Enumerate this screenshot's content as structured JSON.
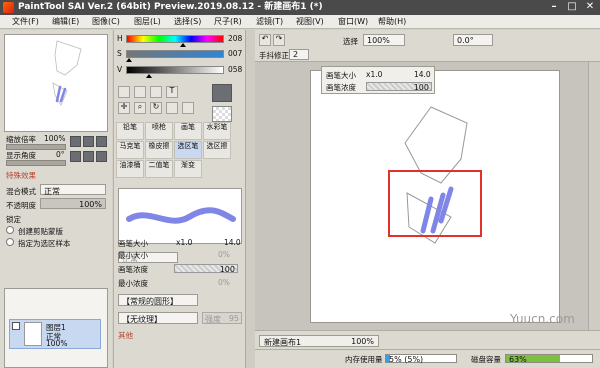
{
  "window": {
    "title": "PaintTool SAI Ver.2 (64bit) Preview.2019.08.12 - 新建画布1 (*)",
    "minimize": "–",
    "maximize": "□",
    "close": "✕"
  },
  "menu": [
    "文件(F)",
    "编辑(E)",
    "图像(C)",
    "图层(L)",
    "选择(S)",
    "尺子(R)",
    "滤镜(T)",
    "视图(V)",
    "窗口(W)",
    "帮助(H)"
  ],
  "navigator": {
    "zoom_label": "缩放倍率",
    "zoom_value": "100%",
    "angle_label": "显示角度",
    "angle_value": "0°"
  },
  "color": {
    "h_label": "H",
    "h_value": "208",
    "s_label": "S",
    "s_value": "007",
    "v_label": "V",
    "v_value": "058",
    "fg": "#6b6f74",
    "h_frac": 0.58,
    "s_frac": 0.03,
    "v_frac": 0.23
  },
  "layer_props": {
    "section": "特殊效果",
    "blend_label": "混合模式",
    "blend_value": "正常",
    "opacity_label": "不透明度",
    "opacity_value": "100%",
    "lock_label": "锁定",
    "clip_label": "创建剪贴蒙版",
    "ref_label": "指定为选区样本"
  },
  "brush_tabs": [
    [
      "铅笔",
      "喷枪",
      "画笔",
      "水彩笔"
    ],
    [
      "马克笔",
      "橡皮擦",
      "选区笔",
      "选区擦"
    ],
    [
      "油漆桶",
      "二值笔",
      "渐变",
      ""
    ]
  ],
  "brush_mode": "正常",
  "brush_params": {
    "size_label": "画笔大小",
    "size_mult": "x1.0",
    "size_value": "14.0",
    "min_size_label": "最小大小",
    "min_size_value": "0%",
    "density_label": "画笔浓度",
    "density_value": "100",
    "min_density_label": "最小浓度",
    "min_density_value": "0%",
    "shape_label": "【常规的圆形】",
    "texture_label": "【无纹理】",
    "texture_strength": "强度",
    "texture_value": "95",
    "other_label": "其他"
  },
  "layer": {
    "name": "图层1",
    "mode": "正常",
    "opacity": "100%"
  },
  "canvas_toolbar": {
    "zoom": "100%",
    "angle": "0.0°",
    "selection_label": "选择",
    "stabilizer_label": "手抖修正",
    "stabilizer_value": "2"
  },
  "floating": {
    "size_label": "画笔大小",
    "size_mult": "x1.0",
    "size_value": "14.0",
    "density_label": "画笔浓度",
    "density_value": "100"
  },
  "status": {
    "doc_name": "新建画布1",
    "doc_zoom": "100%",
    "mem_label": "内存使用量",
    "mem_value": "5% (5%)",
    "mem_frac": 0.05,
    "disk_label": "磁盘容量",
    "disk_value": "63%",
    "disk_frac": 0.63
  },
  "watermark": "Yuucn.com",
  "colors": {
    "highlight": "#e0312a",
    "stroke": "#7f86e6"
  }
}
